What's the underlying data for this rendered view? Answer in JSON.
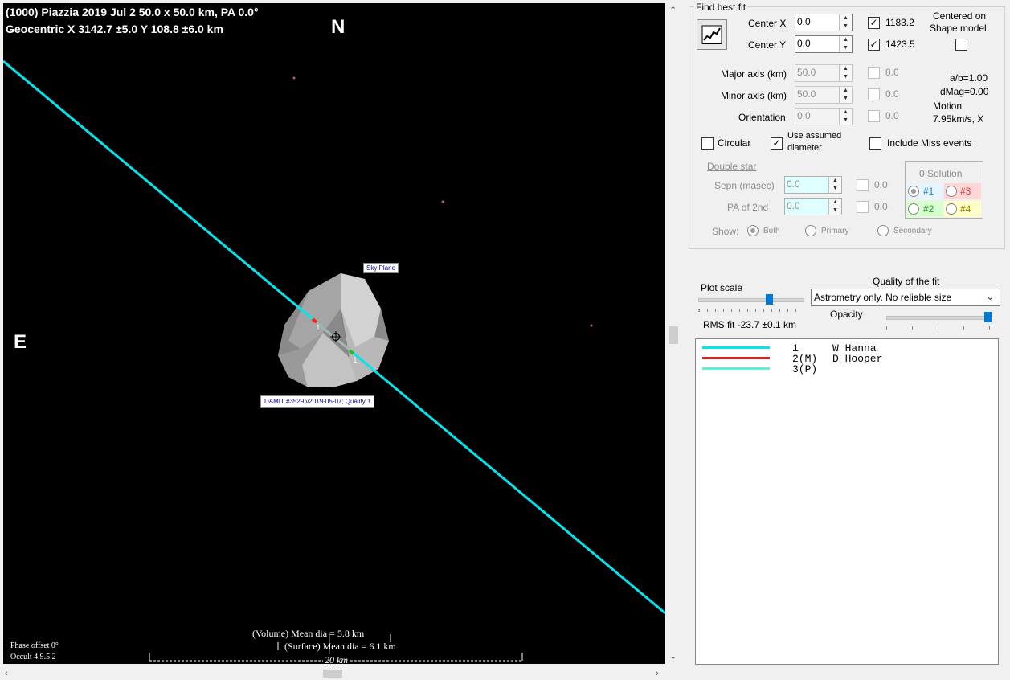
{
  "plot": {
    "title_line1": "(1000) Piazzia  2019 Jul 2  50.0 x 50.0 km, PA 0.0°",
    "title_line2": "Geocentric  X  3142.7 ±5.0  Y 108.8 ±6.0 km",
    "north": "N",
    "east": "E",
    "sky_plane_label": "Sky Plane",
    "damit_label": "DAMIT #3529 v2019-05-07; Quality 1",
    "chord_label_1": "1",
    "chord_label_2": "1",
    "volume_dia": "(Volume) Mean dia = 5.8 km",
    "surface_dia": "(Surface) Mean dia = 6.1 km",
    "scale_bar": "20 km",
    "phase_offset": "Phase offset 0°",
    "version": "Occult 4.9.5.2",
    "colors": {
      "background": "#000000",
      "chord": "#00e5ee",
      "disappear": "#ff2020",
      "reappear": "#20c020"
    }
  },
  "panel": {
    "find_best_fit": "Find best fit",
    "center_x_label": "Center X",
    "center_x_value": "0.0",
    "center_y_label": "Center Y",
    "center_y_value": "0.0",
    "center_x_check": "1183.2",
    "center_y_check": "1423.5",
    "centered_on": "Centered on",
    "shape_model": "Shape model",
    "major_axis_label": "Major axis (km)",
    "major_axis_value": "50.0",
    "major_axis_check": "0.0",
    "minor_axis_label": "Minor axis (km)",
    "minor_axis_value": "50.0",
    "minor_axis_check": "0.0",
    "orientation_label": "Orientation",
    "orientation_value": "0.0",
    "orientation_check": "0.0",
    "ab_ratio": "a/b=1.00",
    "dmag": "dMag=0.00",
    "motion_label": "Motion",
    "motion_value": "7.95km/s, X",
    "circular": "Circular",
    "use_assumed_1": "Use assumed",
    "use_assumed_2": "diameter",
    "include_miss": "Include Miss events",
    "double_star": "Double star",
    "sepn_label": "Sepn (masec)",
    "sepn_value": "0.0",
    "sepn_check": "0.0",
    "pa2_label": "PA of 2nd",
    "pa2_value": "0.0",
    "pa2_check": "0.0",
    "solution_title": "0 Solution",
    "sol1": "#1",
    "sol2": "#2",
    "sol3": "#3",
    "sol4": "#4",
    "show_label": "Show:",
    "show_both": "Both",
    "show_primary": "Primary",
    "show_secondary": "Secondary",
    "plot_scale": "Plot scale",
    "quality_title": "Quality of the fit",
    "quality_value": "Astrometry only. No reliable size",
    "opacity": "Opacity",
    "rms_fit": "RMS fit -23.7 ±0.1 km",
    "legend": [
      {
        "color": "#00e5ee",
        "num": "1",
        "name": "W Hanna"
      },
      {
        "color": "#e02020",
        "num": "2(M)",
        "name": "D Hooper"
      },
      {
        "color": "#60f0d8",
        "num": "3(P)",
        "name": ""
      }
    ]
  }
}
